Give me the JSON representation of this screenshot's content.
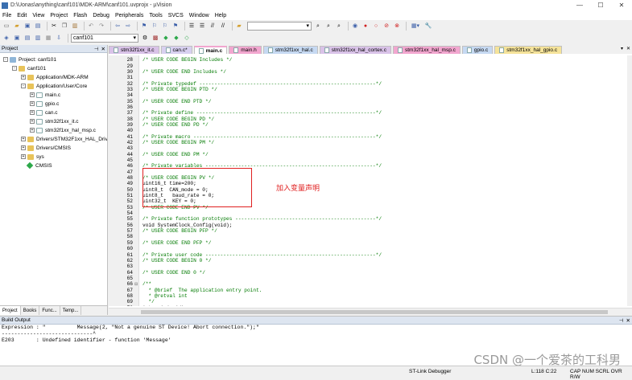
{
  "window": {
    "title": "D:\\Uonas\\anything\\canf101\\MDK-ARM\\canf101.uvprojx - µVision"
  },
  "menu": [
    "File",
    "Edit",
    "View",
    "Project",
    "Flash",
    "Debug",
    "Peripherals",
    "Tools",
    "SVCS",
    "Window",
    "Help"
  ],
  "toolbar": {
    "target_name": "canf101"
  },
  "project_panel": {
    "header": "Project",
    "tree": [
      {
        "label": "Project: canf101",
        "level": 0,
        "kind": "target",
        "exp": "-"
      },
      {
        "label": "canf101",
        "level": 1,
        "kind": "folder",
        "exp": "-"
      },
      {
        "label": "Application/MDK-ARM",
        "level": 2,
        "kind": "folder",
        "exp": "+"
      },
      {
        "label": "Application/User/Core",
        "level": 2,
        "kind": "folder",
        "exp": "-"
      },
      {
        "label": "main.c",
        "level": 3,
        "kind": "file",
        "exp": "+"
      },
      {
        "label": "gpio.c",
        "level": 3,
        "kind": "file",
        "exp": "+"
      },
      {
        "label": "can.c",
        "level": 3,
        "kind": "file",
        "exp": "+"
      },
      {
        "label": "stm32f1xx_it.c",
        "level": 3,
        "kind": "file",
        "exp": "+"
      },
      {
        "label": "stm32f1xx_hal_msp.c",
        "level": 3,
        "kind": "file",
        "exp": "+"
      },
      {
        "label": "Drivers/STM32F1xx_HAL_Driv",
        "level": 2,
        "kind": "folder",
        "exp": "+"
      },
      {
        "label": "Drivers/CMSIS",
        "level": 2,
        "kind": "folder",
        "exp": "+"
      },
      {
        "label": "sys",
        "level": 2,
        "kind": "folder",
        "exp": "+"
      },
      {
        "label": "CMSIS",
        "level": 2,
        "kind": "component",
        "exp": ""
      }
    ],
    "bottom_tabs": [
      "Project",
      "Books",
      "Func...",
      "Temp..."
    ]
  },
  "editor": {
    "tabs": [
      {
        "label": "stm32f1xx_it.c",
        "color": "#d9c2e8",
        "active": false
      },
      {
        "label": "can.c*",
        "color": "#d8d0f0",
        "active": false
      },
      {
        "label": "main.c",
        "color": "#f2a6cf",
        "active": true
      },
      {
        "label": "main.h",
        "color": "#f2a6cf",
        "active": false
      },
      {
        "label": "stm32f1xx_hal.c",
        "color": "#c6d9f2",
        "active": false
      },
      {
        "label": "stm32f1xx_hal_cortex.c",
        "color": "#d9c2e8",
        "active": false
      },
      {
        "label": "stm32f1xx_hal_msp.c",
        "color": "#f2a6cf",
        "active": false
      },
      {
        "label": "gpio.c",
        "color": "#c6d9f2",
        "active": false
      },
      {
        "label": "stm32f1xx_hal_gpio.c",
        "color": "#f5e39a",
        "active": false
      }
    ],
    "lines": [
      {
        "n": "28",
        "f": "",
        "t": "/* USER CODE BEGIN Includes */",
        "c": "cmt"
      },
      {
        "n": "29",
        "f": "",
        "t": "",
        "c": ""
      },
      {
        "n": "30",
        "f": "",
        "t": "/* USER CODE END Includes */",
        "c": "cmt"
      },
      {
        "n": "31",
        "f": "",
        "t": "",
        "c": ""
      },
      {
        "n": "32",
        "f": "",
        "t": "/* Private typedef -----------------------------------------------------------*/",
        "c": "cmt"
      },
      {
        "n": "33",
        "f": "",
        "t": "/* USER CODE BEGIN PTD */",
        "c": "cmt"
      },
      {
        "n": "34",
        "f": "",
        "t": "",
        "c": ""
      },
      {
        "n": "35",
        "f": "",
        "t": "/* USER CODE END PTD */",
        "c": "cmt"
      },
      {
        "n": "36",
        "f": "",
        "t": "",
        "c": ""
      },
      {
        "n": "37",
        "f": "",
        "t": "/* Private define ------------------------------------------------------------*/",
        "c": "cmt"
      },
      {
        "n": "38",
        "f": "",
        "t": "/* USER CODE BEGIN PD */",
        "c": "cmt"
      },
      {
        "n": "39",
        "f": "",
        "t": "/* USER CODE END PD */",
        "c": "cmt"
      },
      {
        "n": "40",
        "f": "",
        "t": "",
        "c": ""
      },
      {
        "n": "41",
        "f": "",
        "t": "/* Private macro -------------------------------------------------------------*/",
        "c": "cmt"
      },
      {
        "n": "42",
        "f": "",
        "t": "/* USER CODE BEGIN PM */",
        "c": "cmt"
      },
      {
        "n": "43",
        "f": "",
        "t": "",
        "c": ""
      },
      {
        "n": "44",
        "f": "",
        "t": "/* USER CODE END PM */",
        "c": "cmt"
      },
      {
        "n": "45",
        "f": "",
        "t": "",
        "c": ""
      },
      {
        "n": "46",
        "f": "",
        "t": "/* Private variables ---------------------------------------------------------*/",
        "c": "cmt"
      },
      {
        "n": "47",
        "f": "",
        "t": "",
        "c": ""
      },
      {
        "n": "48",
        "f": "",
        "t": "/* USER CODE BEGIN PV */",
        "c": "cmt"
      },
      {
        "n": "49",
        "f": "",
        "t": "uint16_t time=200;",
        "c": ""
      },
      {
        "n": "50",
        "f": "",
        "t": "uint8_t  CAN_mode = 0;",
        "c": ""
      },
      {
        "n": "51",
        "f": "",
        "t": "uint8_t   baud_rate = 0;",
        "c": ""
      },
      {
        "n": "52",
        "f": "",
        "t": "uint32_t  KEY = 0;",
        "c": ""
      },
      {
        "n": "53",
        "f": "",
        "t": "/* USER CODE END PV */",
        "c": "cmt"
      },
      {
        "n": "54",
        "f": "",
        "t": "",
        "c": ""
      },
      {
        "n": "55",
        "f": "",
        "t": "/* Private function prototypes -----------------------------------------------*/",
        "c": "cmt"
      },
      {
        "n": "56",
        "f": "",
        "t": "void SystemClock_Config(void);",
        "c": ""
      },
      {
        "n": "57",
        "f": "",
        "t": "/* USER CODE BEGIN PFP */",
        "c": "cmt"
      },
      {
        "n": "58",
        "f": "",
        "t": "",
        "c": ""
      },
      {
        "n": "59",
        "f": "",
        "t": "/* USER CODE END PFP */",
        "c": "cmt"
      },
      {
        "n": "60",
        "f": "",
        "t": "",
        "c": ""
      },
      {
        "n": "61",
        "f": "",
        "t": "/* Private user code ---------------------------------------------------------*/",
        "c": "cmt"
      },
      {
        "n": "62",
        "f": "",
        "t": "/* USER CODE BEGIN 0 */",
        "c": "cmt"
      },
      {
        "n": "63",
        "f": "",
        "t": "",
        "c": ""
      },
      {
        "n": "64",
        "f": "",
        "t": "/* USER CODE END 0 */",
        "c": "cmt"
      },
      {
        "n": "65",
        "f": "",
        "t": "",
        "c": ""
      },
      {
        "n": "66",
        "f": "⊟",
        "t": "/**",
        "c": "cmt"
      },
      {
        "n": "67",
        "f": "",
        "t": "  * @brief  The application entry point.",
        "c": "cmt"
      },
      {
        "n": "68",
        "f": "",
        "t": "  * @retval int",
        "c": "cmt"
      },
      {
        "n": "69",
        "f": "",
        "t": "  */",
        "c": "cmt"
      },
      {
        "n": "70",
        "f": "",
        "t": "int main(void)",
        "c": ""
      },
      {
        "n": "71",
        "f": "⊟",
        "t": "{",
        "c": ""
      }
    ]
  },
  "annotation": {
    "text": "加入变量声明"
  },
  "build_output": {
    "header": "Build Output",
    "lines": [
      "Expression : \"          Message(2, \"Not a genuine ST Device! Abort connection.\");\"",
      "-----------------------------^",
      "E203       : Undefined identifier - function 'Message'"
    ]
  },
  "statusbar": {
    "debugger": "ST-Link Debugger",
    "position": "L:118 C:22",
    "flags": "CAP  NUM  SCRL  OVR  R/W"
  },
  "watermark": "CSDN @一个爱茶的工科男"
}
